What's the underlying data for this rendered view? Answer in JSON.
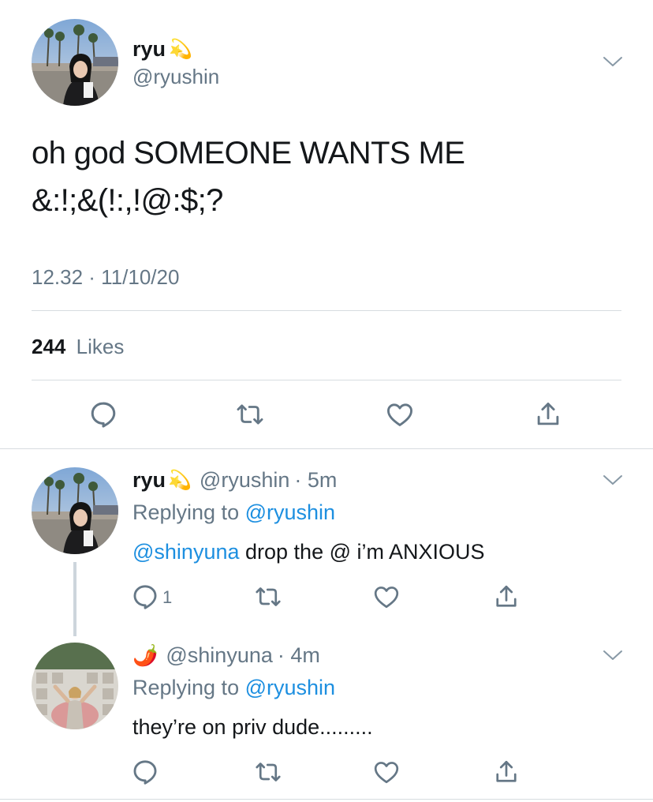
{
  "main_tweet": {
    "display_name": "ryu",
    "name_emoji": "💫",
    "handle": "@ryushin",
    "text_line1": "oh god SOMEONE WANTS ME",
    "text_line2": "&:!;&(!:,!@:$;?",
    "timestamp": "12.32 · 11/10/20",
    "likes_count": "244",
    "likes_label": "Likes"
  },
  "replies": [
    {
      "display_name": "ryu",
      "name_emoji": "💫",
      "handle": "@ryushin",
      "time": "· 5m",
      "replying_prefix": "Replying to",
      "replying_handle": "@ryushin",
      "mention": "@shinyuna",
      "text": "drop the @ i’m ANXIOUS",
      "reply_count": "1"
    },
    {
      "name_emoji": "🌶️",
      "handle": "@shinyuna",
      "time": "· 4m",
      "replying_prefix": "Replying to",
      "replying_handle": "@ryushin",
      "text": "they’re on priv dude........."
    }
  ],
  "colors": {
    "link": "#1d8fe0",
    "muted": "#657786",
    "divider": "#d7dce0",
    "text": "#14171a"
  },
  "icons": [
    "chevron-down-icon",
    "reply-icon",
    "retweet-icon",
    "like-icon",
    "share-icon"
  ]
}
